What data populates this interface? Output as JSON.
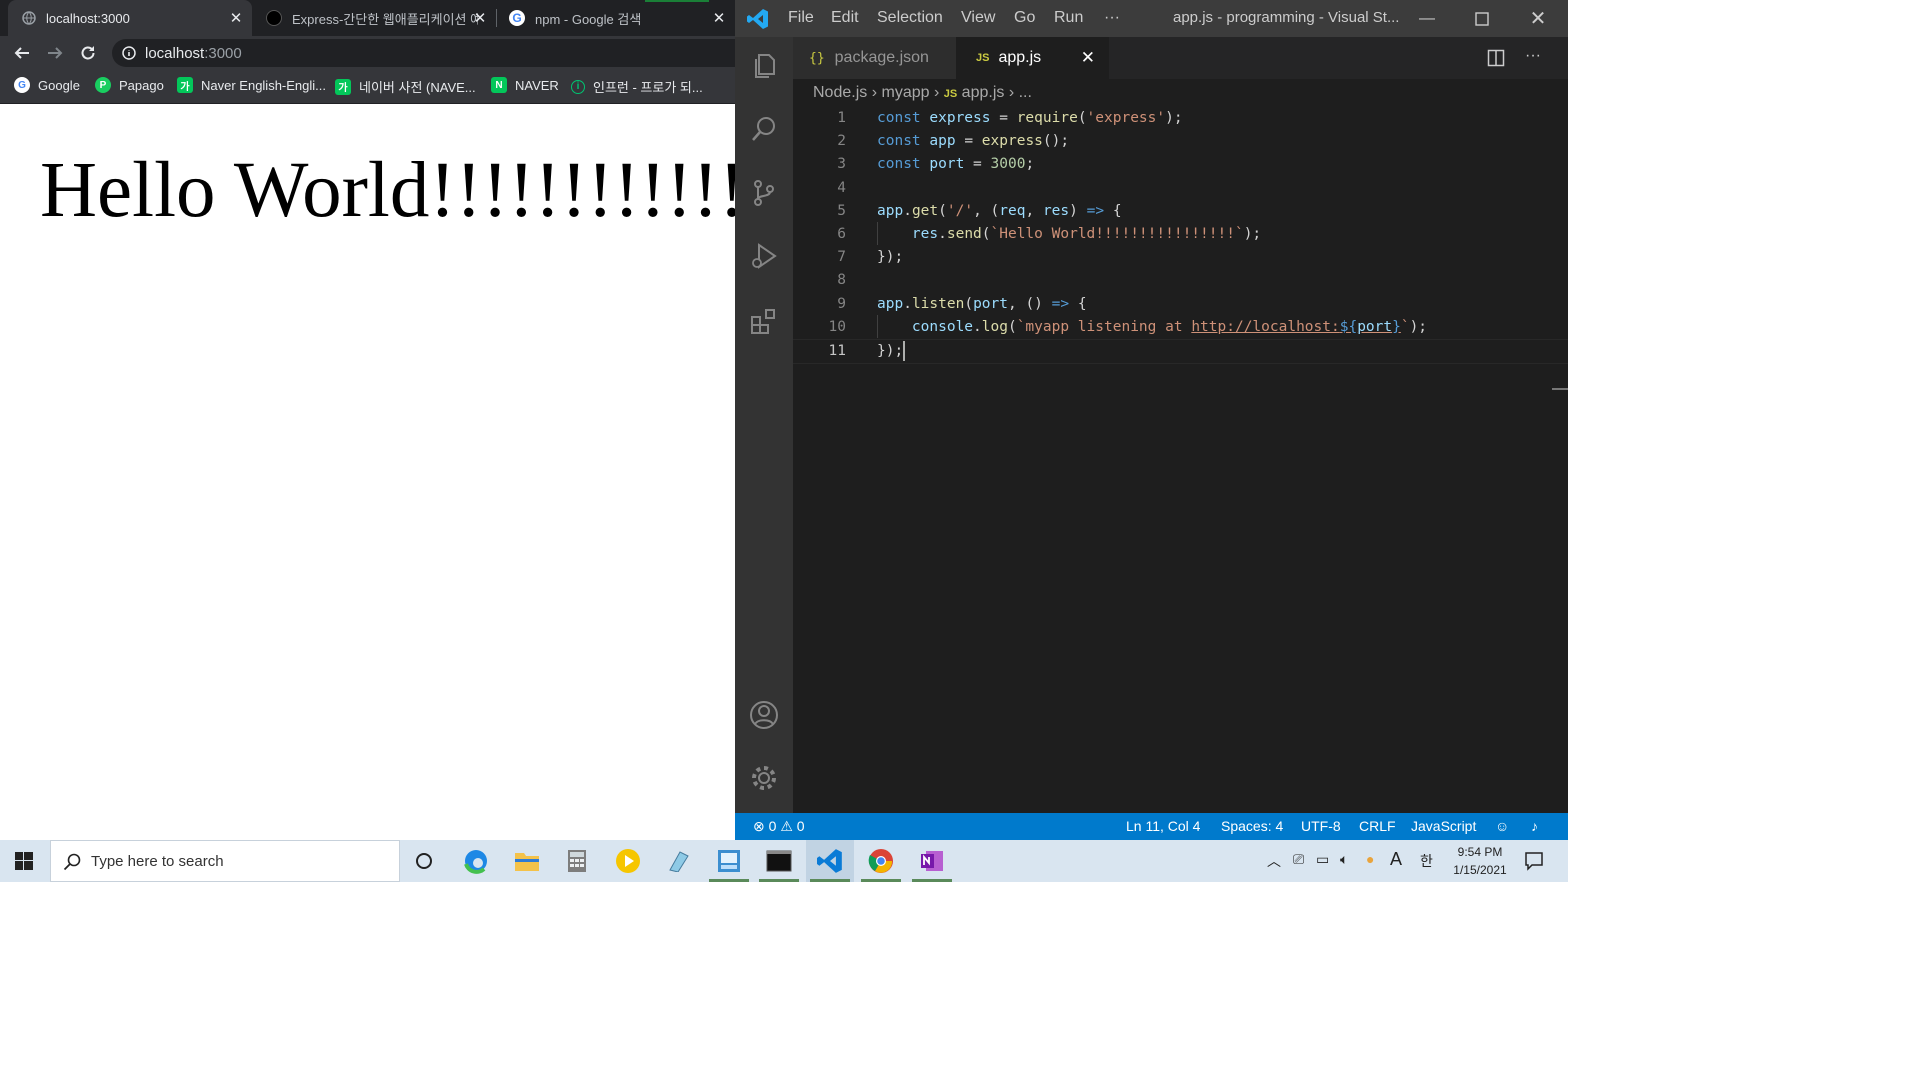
{
  "browser": {
    "tabs": [
      {
        "title": "localhost:3000",
        "active": true
      },
      {
        "title": "Express-간단한 웹애플리케이션 예",
        "active": false
      },
      {
        "title": "npm - Google 검색",
        "active": false
      }
    ],
    "url_host": "localhost",
    "url_port": ":3000",
    "bookmarks": [
      {
        "label": "Google",
        "color": "#4285f4",
        "glyph": "G"
      },
      {
        "label": "Papago",
        "color": "#19ce60",
        "glyph": "P"
      },
      {
        "label": "Naver English-Engli...",
        "color": "#03c75a",
        "glyph": "가"
      },
      {
        "label": "네이버 사전 (NAVE...",
        "color": "#03c75a",
        "glyph": "가"
      },
      {
        "label": "NAVER",
        "color": "#03c75a",
        "glyph": "N"
      },
      {
        "label": "인프런 - 프로가 되...",
        "color": "#00c471",
        "glyph": "i"
      }
    ],
    "page_heading": "Hello World!!!!!!!!!!!!!!!!"
  },
  "vscode": {
    "menu": [
      "File",
      "Edit",
      "Selection",
      "View",
      "Go",
      "Run",
      "···"
    ],
    "window_title": "app.js - programming - Visual St...",
    "editor_tabs": [
      {
        "icon": "{}",
        "label": "package.json",
        "active": false
      },
      {
        "icon": "JS",
        "label": "app.js",
        "active": true
      }
    ],
    "breadcrumb": {
      "folder1": "Node.js",
      "folder2": "myapp",
      "file": "app.js",
      "more": "..."
    },
    "code_lines": [
      "const express = require('express');",
      "const app = express();",
      "const port = 3000;",
      "",
      "app.get('/', (req, res) => {",
      "    res.send(`Hello World!!!!!!!!!!!!!!!!`);",
      "});",
      "",
      "app.listen(port, () => {",
      "    console.log(`myapp listening at http://localhost:${port}`);",
      "});"
    ],
    "current_line": 11,
    "status": {
      "errors": "0",
      "warnings": "0",
      "position": "Ln 11, Col 4",
      "spaces": "Spaces: 4",
      "encoding": "UTF-8",
      "eol": "CRLF",
      "language": "JavaScript"
    },
    "colors": {
      "accent": "#007acc",
      "keyword": "#569cd6",
      "string": "#ce9178",
      "function": "#dcdcaa",
      "variable": "#9cdcfe",
      "number": "#b5cea8"
    }
  },
  "taskbar": {
    "search_placeholder": "Type here to search",
    "time": "9:54 PM",
    "date": "1/15/2021",
    "ime": "A",
    "ime_korean": "한"
  }
}
